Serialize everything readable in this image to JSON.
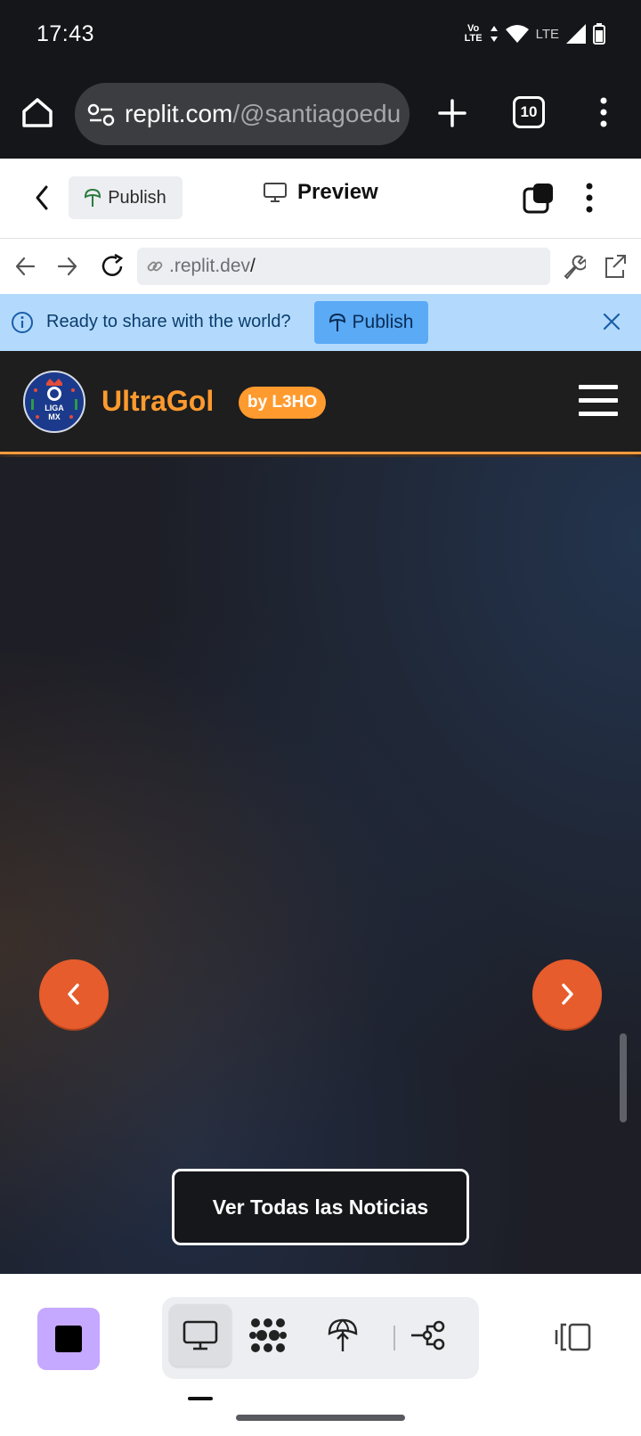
{
  "status_bar": {
    "time": "17:43",
    "volte": "Vo\nLTE",
    "network": "LTE",
    "icons": [
      "volte-icon",
      "data-arrows-icon",
      "wifi-icon",
      "signal-icon",
      "battery-icon"
    ]
  },
  "browser": {
    "url_host": "replit.com",
    "url_path": "/@santiagoedu",
    "tab_count": "10",
    "icons": [
      "home-icon",
      "site-settings-icon",
      "new-tab-icon",
      "tabs-icon",
      "more-vert-icon"
    ]
  },
  "replit_header": {
    "publish_label": "Publish",
    "title": "Preview"
  },
  "preview_nav": {
    "url_text": ".replit.dev",
    "url_slash": "/"
  },
  "banner": {
    "message": "Ready to share with the world?",
    "publish_label": "Publish"
  },
  "site": {
    "logo_text": "LIGA MX",
    "title": "UltraGol",
    "badge": "by L3HO",
    "news_button": "Ver Todas las Noticias",
    "colors": {
      "accent": "#ff9a2e",
      "carousel": "#e65c2c"
    }
  },
  "bottom_bar": {
    "tools": [
      "preview-tool",
      "agent-tool",
      "deploy-tool",
      "git-tool"
    ],
    "accent": "#c5a8ff"
  }
}
